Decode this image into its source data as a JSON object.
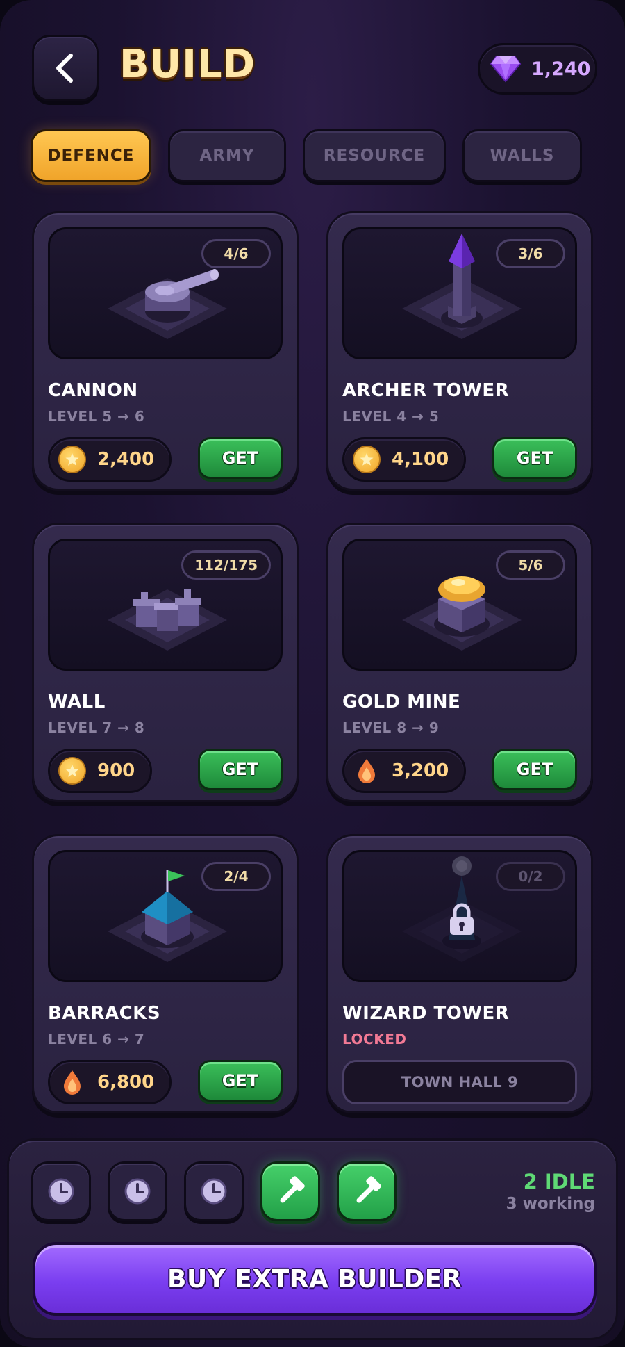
{
  "header": {
    "title": "BUILD",
    "gems": "1,240"
  },
  "tabs": [
    {
      "label": "DEFENCE",
      "active": true
    },
    {
      "label": "ARMY",
      "active": false
    },
    {
      "label": "RESOURCE",
      "active": false
    },
    {
      "label": "WALLS",
      "active": false
    }
  ],
  "cards": [
    {
      "name": "CANNON",
      "level": "LEVEL 5 → 6",
      "count": "4/6",
      "cost": "2,400",
      "currency": "coin",
      "action": "GET"
    },
    {
      "name": "ARCHER TOWER",
      "level": "LEVEL 4 → 5",
      "count": "3/6",
      "cost": "4,100",
      "currency": "coin",
      "action": "GET"
    },
    {
      "name": "WALL",
      "level": "LEVEL 7 → 8",
      "count": "112/175",
      "cost": "900",
      "currency": "coin",
      "action": "GET"
    },
    {
      "name": "GOLD MINE",
      "level": "LEVEL 8 → 9",
      "count": "5/6",
      "cost": "3,200",
      "currency": "elixir",
      "action": "GET"
    },
    {
      "name": "BARRACKS",
      "level": "LEVEL 6 → 7",
      "count": "2/4",
      "cost": "6,800",
      "currency": "elixir",
      "action": "GET"
    },
    {
      "name": "WIZARD TOWER",
      "level": "LOCKED",
      "count": "0/2",
      "requirement": "TOWN HALL 9"
    }
  ],
  "builders": {
    "slots": [
      "clock-icon",
      "clock-icon",
      "clock-icon",
      "hammer-icon",
      "hammer-icon"
    ],
    "idle": "2 IDLE",
    "working": "3 working"
  },
  "buy_button": "BUY EXTRA BUILDER",
  "colors": {
    "accent_gold": "#f0a42a",
    "get_green": "#2ea84a",
    "buy_purple": "#7a3ef0",
    "idle_green": "#5fd975",
    "gem_purple": "#d6a8ff"
  }
}
